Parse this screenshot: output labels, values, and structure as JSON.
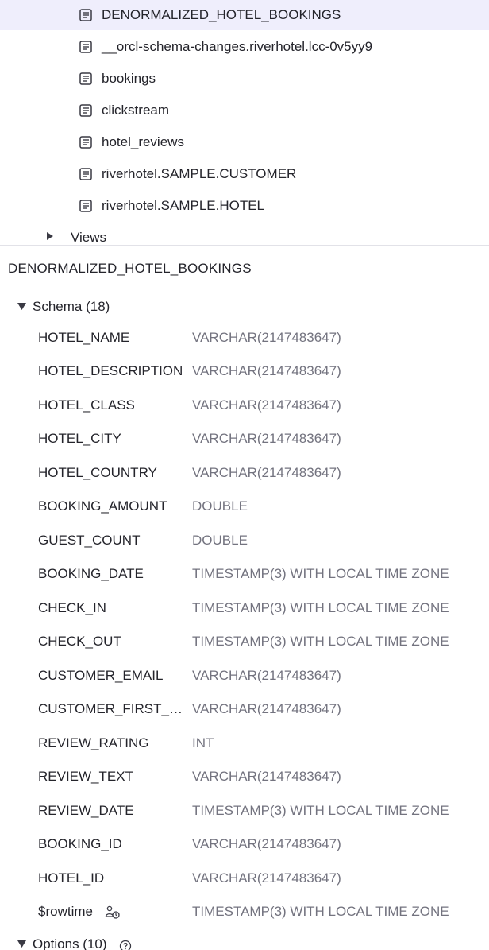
{
  "tree": {
    "items": [
      {
        "label": "DENORMALIZED_HOTEL_BOOKINGS",
        "icon": "document-icon",
        "selected": true
      },
      {
        "label": "__orcl-schema-changes.riverhotel.lcc-0v5yy9",
        "icon": "document-icon",
        "selected": false
      },
      {
        "label": "bookings",
        "icon": "document-icon",
        "selected": false
      },
      {
        "label": "clickstream",
        "icon": "document-icon",
        "selected": false
      },
      {
        "label": "hotel_reviews",
        "icon": "document-icon",
        "selected": false
      },
      {
        "label": "riverhotel.SAMPLE.CUSTOMER",
        "icon": "document-icon",
        "selected": false
      },
      {
        "label": "riverhotel.SAMPLE.HOTEL",
        "icon": "document-icon",
        "selected": false
      }
    ],
    "views_label": "Views"
  },
  "detail": {
    "title": "DENORMALIZED_HOTEL_BOOKINGS",
    "schema_label": "Schema (18)",
    "fields": [
      {
        "name": "HOTEL_NAME",
        "type": "VARCHAR(2147483647)"
      },
      {
        "name": "HOTEL_DESCRIPTION",
        "type": "VARCHAR(2147483647)"
      },
      {
        "name": "HOTEL_CLASS",
        "type": "VARCHAR(2147483647)"
      },
      {
        "name": "HOTEL_CITY",
        "type": "VARCHAR(2147483647)"
      },
      {
        "name": "HOTEL_COUNTRY",
        "type": "VARCHAR(2147483647)"
      },
      {
        "name": "BOOKING_AMOUNT",
        "type": "DOUBLE"
      },
      {
        "name": "GUEST_COUNT",
        "type": "DOUBLE"
      },
      {
        "name": "BOOKING_DATE",
        "type": "TIMESTAMP(3) WITH LOCAL TIME ZONE"
      },
      {
        "name": "CHECK_IN",
        "type": "TIMESTAMP(3) WITH LOCAL TIME ZONE"
      },
      {
        "name": "CHECK_OUT",
        "type": "TIMESTAMP(3) WITH LOCAL TIME ZONE"
      },
      {
        "name": "CUSTOMER_EMAIL",
        "type": "VARCHAR(2147483647)"
      },
      {
        "name": "CUSTOMER_FIRST_N...",
        "type": "VARCHAR(2147483647)"
      },
      {
        "name": "REVIEW_RATING",
        "type": "INT"
      },
      {
        "name": "REVIEW_TEXT",
        "type": "VARCHAR(2147483647)"
      },
      {
        "name": "REVIEW_DATE",
        "type": "TIMESTAMP(3) WITH LOCAL TIME ZONE"
      },
      {
        "name": "BOOKING_ID",
        "type": "VARCHAR(2147483647)"
      },
      {
        "name": "HOTEL_ID",
        "type": "VARCHAR(2147483647)"
      },
      {
        "name": "$rowtime",
        "type": "TIMESTAMP(3) WITH LOCAL TIME ZONE",
        "icon": "rowtime-icon"
      }
    ],
    "options_label": "Options (10)",
    "options_icon": "help-icon"
  },
  "colors": {
    "accent": "#6b5fdc",
    "selected_bg": "#efeefc",
    "type_text": "#73737f"
  }
}
